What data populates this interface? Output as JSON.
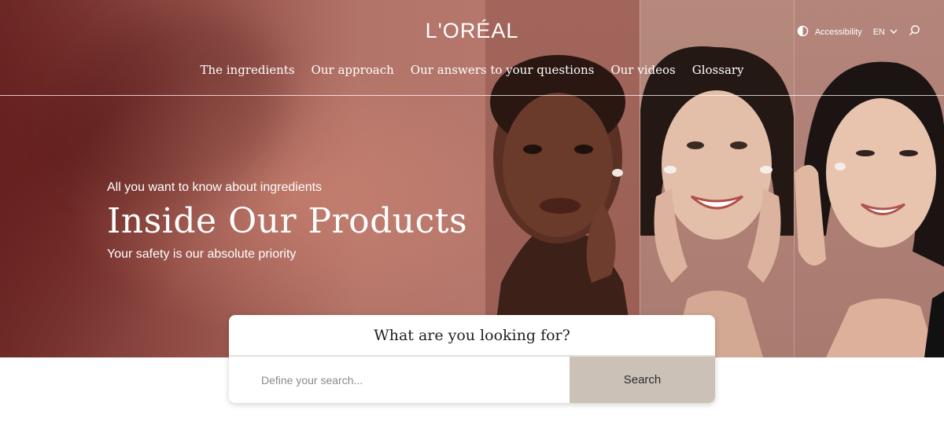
{
  "brand": {
    "logo_text": "L'ORÉAL"
  },
  "nav": {
    "items": [
      {
        "label": "The ingredients"
      },
      {
        "label": "Our approach"
      },
      {
        "label": "Our answers to your questions"
      },
      {
        "label": "Our videos"
      },
      {
        "label": "Glossary"
      }
    ]
  },
  "utilities": {
    "accessibility_label": "Accessibility",
    "accessibility_icon": "contrast-icon",
    "language": "EN",
    "language_icon": "chevron-down-icon",
    "search_icon": "search-icon"
  },
  "hero": {
    "tagline": "All you want to know about ingredients",
    "title": "Inside Our Products",
    "subtitle": "Your safety is our absolute priority"
  },
  "search": {
    "heading": "What are you looking for?",
    "placeholder": "Define your search...",
    "button_label": "Search"
  },
  "colors": {
    "hero_base": "#b6786d",
    "search_button": "#cbc1b6",
    "text_light": "#ffffff",
    "text_dark": "#1f1f1f"
  }
}
